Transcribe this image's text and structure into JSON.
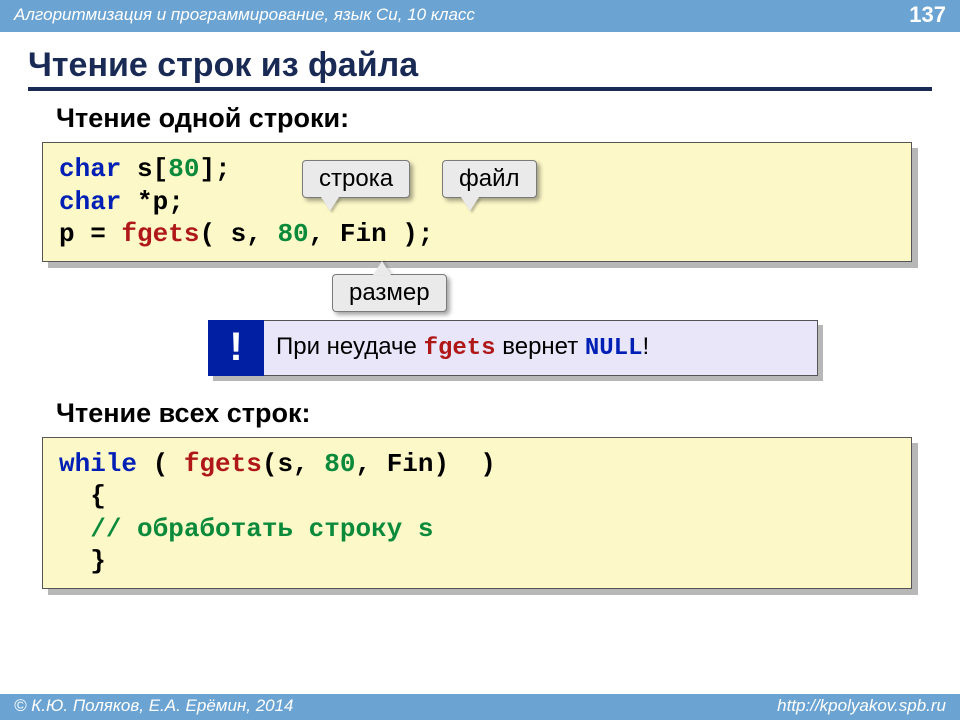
{
  "header": {
    "course": "Алгоритмизация и программирование, язык Си, 10 класс",
    "page": "137"
  },
  "title": "Чтение строк из файла",
  "section1": {
    "heading": "Чтение одной строки:",
    "code": {
      "l1_kw": "char",
      "l1_rest": " s[",
      "l1_num": "80",
      "l1_tail": "];",
      "l2_kw": "char",
      "l2_rest": " *p;",
      "l3_a": "p = ",
      "l3_fn": "fgets",
      "l3_b": "( s, ",
      "l3_num": "80",
      "l3_c": ", Fin );"
    },
    "callouts": {
      "str": "строка",
      "file": "файл",
      "size": "размер"
    }
  },
  "notice": {
    "bang": "!",
    "pre": "При неудаче ",
    "func": "fgets",
    "mid": " вернет ",
    "null": "NULL",
    "suf": "!"
  },
  "section2": {
    "heading": "Чтение всех строк:",
    "code": {
      "l1_kw": "while",
      "l1_a": " ( ",
      "l1_fn": "fgets",
      "l1_b": "(s, ",
      "l1_num": "80",
      "l1_c": ", Fin)  )",
      "l2": "  {",
      "l3_pre": "  ",
      "l3_cmt": "// обработать строку s",
      "l4": "  }"
    }
  },
  "footer": {
    "left": "© К.Ю. Поляков, Е.А. Ерёмин, 2014",
    "right": "http://kpolyakov.spb.ru"
  }
}
